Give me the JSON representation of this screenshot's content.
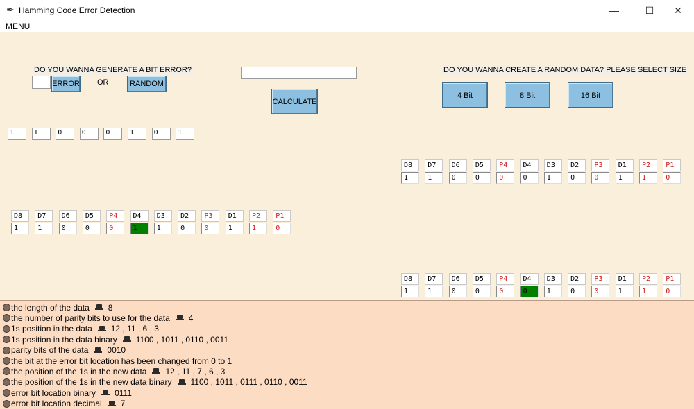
{
  "window": {
    "title": "Hamming Code Error Detection",
    "minimize_glyph": "—",
    "maximize_glyph": "☐",
    "close_glyph": "✕"
  },
  "menu": {
    "label": "MENU"
  },
  "controls": {
    "error_question": "DO YOU WANNA GENERATE A BIT ERROR?",
    "error_input_value": "",
    "error_button": "ERROR",
    "or_label": "OR",
    "random_button": "RANDOM",
    "data_input_value": "",
    "calculate_button": "CALCULATE",
    "random_question": "DO YOU WANNA CREATE A RANDOM DATA? PLEASE SELECT SIZE",
    "size_buttons": [
      "4 Bit",
      "8 Bit",
      "16 Bit"
    ]
  },
  "input_bits": [
    "1",
    "1",
    "0",
    "0",
    "0",
    "1",
    "0",
    "1"
  ],
  "tables": {
    "encoded": {
      "headers": [
        "D8",
        "D7",
        "D6",
        "D5",
        "P4",
        "D4",
        "D3",
        "D2",
        "P3",
        "D1",
        "P2",
        "P1"
      ],
      "values": [
        "1",
        "1",
        "0",
        "0",
        "0",
        "0",
        "1",
        "0",
        "0",
        "1",
        "1",
        "0"
      ]
    },
    "error": {
      "headers": [
        "D8",
        "D7",
        "D6",
        "D5",
        "P4",
        "D4",
        "D3",
        "D2",
        "P3",
        "D1",
        "P2",
        "P1"
      ],
      "values": [
        "1",
        "1",
        "0",
        "0",
        "0",
        "1",
        "1",
        "0",
        "0",
        "1",
        "1",
        "0"
      ]
    },
    "corrected": {
      "headers": [
        "D8",
        "D7",
        "D6",
        "D5",
        "P4",
        "D4",
        "D3",
        "D2",
        "P3",
        "D1",
        "P2",
        "P1"
      ],
      "values": [
        "1",
        "1",
        "0",
        "0",
        "0",
        "0",
        "1",
        "0",
        "0",
        "1",
        "1",
        "0"
      ]
    }
  },
  "info_lines": [
    {
      "label": "the length of the data",
      "value": "8"
    },
    {
      "label": "the number of parity bits to use for the data",
      "value": "4"
    },
    {
      "label": "1s position in the data",
      "value": "12 , 11 , 6 , 3"
    },
    {
      "label": "1s position in the data binary",
      "value": "1100 , 1011 , 0110 , 0011"
    },
    {
      "label": "parity bits of the data",
      "value": "0010"
    },
    {
      "label": "the bit at the error bit location has been changed from 0 to 1",
      "value": ""
    },
    {
      "label": "the position of the 1s in the new data",
      "value": "12 , 11 , 7 , 6 , 3"
    },
    {
      "label": "the position of the 1s in the new data binary",
      "value": "1100 , 1011 , 0111 , 0110 , 0011"
    },
    {
      "label": "error bit location binary",
      "value": "0111"
    },
    {
      "label": "error bit location decimal",
      "value": "7"
    }
  ],
  "colors": {
    "background": "#faefdb",
    "button": "#8cbfe0",
    "info_panel": "#fddcc4",
    "parity_text": "#d01818",
    "error_cell": "#008000"
  },
  "icons": {
    "app": "feather-icon",
    "bullet": "circle-bullet-icon",
    "separator": "laptop-icon"
  }
}
